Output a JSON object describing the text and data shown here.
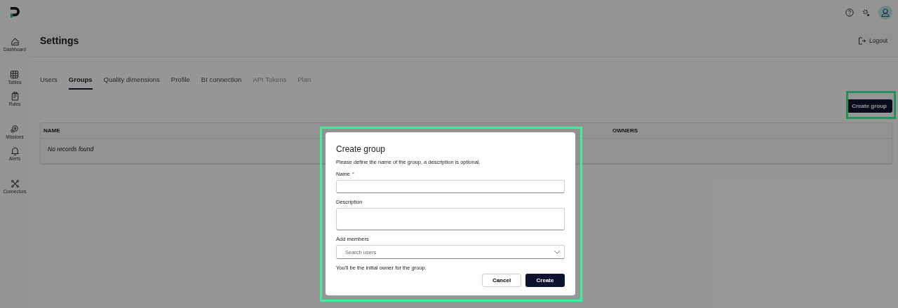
{
  "sidebar": {
    "items": [
      {
        "label": "Dashboard"
      },
      {
        "label": "Tables"
      },
      {
        "label": "Rules"
      },
      {
        "label": "Missions"
      },
      {
        "label": "Alerts"
      },
      {
        "label": "Connectors"
      }
    ]
  },
  "header": {
    "title": "Settings",
    "logout": "Logout"
  },
  "tabs": [
    {
      "label": "Users",
      "selected": false,
      "disabled": false
    },
    {
      "label": "Groups",
      "selected": true,
      "disabled": false
    },
    {
      "label": "Quality dimensions",
      "selected": false,
      "disabled": false
    },
    {
      "label": "Profile",
      "selected": false,
      "disabled": false
    },
    {
      "label": "BI connection",
      "selected": false,
      "disabled": false
    },
    {
      "label": "API Tokens",
      "selected": false,
      "disabled": true
    },
    {
      "label": "Plan",
      "selected": false,
      "disabled": true
    }
  ],
  "create_button": {
    "label": "Create group",
    "highlighted": true
  },
  "table": {
    "columns": [
      "NAME",
      "OWNERS"
    ],
    "empty_message": "No records found"
  },
  "dialog": {
    "title": "Create group",
    "highlighted": true,
    "intro": "Please define the name of the group, a description is optional.",
    "name_label": "Name",
    "name_required_mark": "*",
    "description_label": "Description",
    "members_label": "Add members",
    "members_placeholder": "Search users",
    "note": "You'll be the initial owner for the group.",
    "buttons": [
      {
        "label": "Cancel",
        "kind": "secondary"
      },
      {
        "label": "Create",
        "kind": "primary"
      }
    ]
  }
}
